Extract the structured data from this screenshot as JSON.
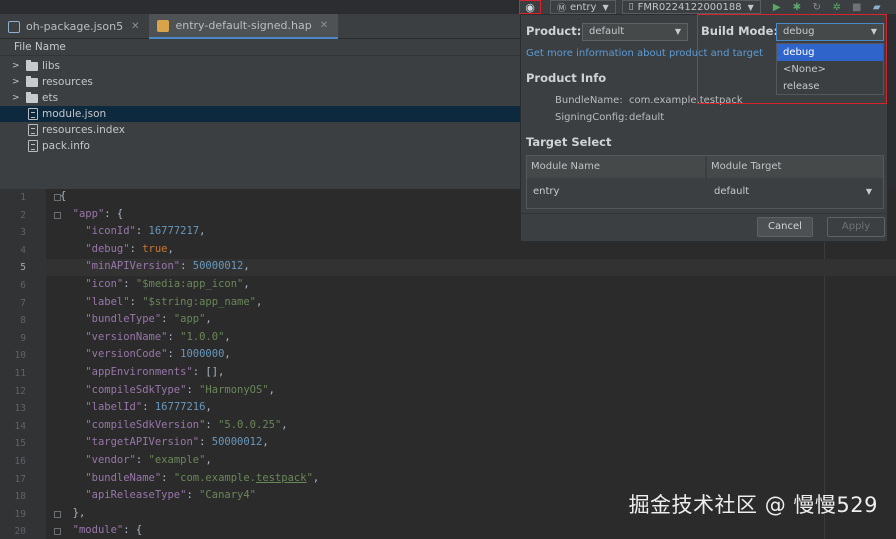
{
  "tabs": [
    {
      "label": "oh-package.json5",
      "icon": "json-file-icon",
      "active": false
    },
    {
      "label": "entry-default-signed.hap",
      "icon": "hap-archive-icon",
      "active": true
    }
  ],
  "tree": {
    "header": "File Name",
    "items": [
      {
        "label": "libs",
        "type": "folder"
      },
      {
        "label": "resources",
        "type": "folder"
      },
      {
        "label": "ets",
        "type": "folder"
      },
      {
        "label": "module.json",
        "type": "file",
        "selected": true
      },
      {
        "label": "resources.index",
        "type": "file"
      },
      {
        "label": "pack.info",
        "type": "file"
      }
    ]
  },
  "toolbar": {
    "module": "entry",
    "device": "FMR0224122000188"
  },
  "dialog": {
    "product_label": "Product:",
    "product_value": "default",
    "build_mode_label": "Build Mode:",
    "build_mode_value": "debug",
    "build_mode_options": [
      "debug",
      "<None>",
      "release"
    ],
    "more_info_link": "Get more information about product and target",
    "product_info_title": "Product Info",
    "bundle_name_label": "BundleName:",
    "bundle_name_value": "com.example.testpack",
    "signing_config_label": "SigningConfig:",
    "signing_config_value": "default",
    "target_select_title": "Target Select",
    "table_headers": [
      "Module Name",
      "Module Target"
    ],
    "table_row": {
      "module_name": "entry",
      "module_target": "default"
    },
    "cancel_label": "Cancel",
    "apply_label": "Apply"
  },
  "editor": {
    "current_line": 5,
    "line_numbers": [
      "1",
      "2",
      "3",
      "4",
      "5",
      "6",
      "7",
      "8",
      "9",
      "10",
      "11",
      "12",
      "13",
      "14",
      "15",
      "16",
      "17",
      "18",
      "19",
      "20"
    ],
    "lines": [
      "{",
      "  \"app\": {",
      "    \"iconId\": 16777217,",
      "    \"debug\": true,",
      "    \"minAPIVersion\": 50000012,",
      "    \"icon\": \"$media:app_icon\",",
      "    \"label\": \"$string:app_name\",",
      "    \"bundleType\": \"app\",",
      "    \"versionName\": \"1.0.0\",",
      "    \"versionCode\": 1000000,",
      "    \"appEnvironments\": [],",
      "    \"compileSdkType\": \"HarmonyOS\",",
      "    \"labelId\": 16777216,",
      "    \"compileSdkVersion\": \"5.0.0.25\",",
      "    \"targetAPIVersion\": 50000012,",
      "    \"vendor\": \"example\",",
      "    \"bundleName\": \"com.example.testpack\",",
      "    \"apiReleaseType\": \"Canary4\"",
      "  },",
      "  \"module\": {"
    ]
  },
  "watermark": "掘金技术社区 @ 慢慢529",
  "colors": {
    "accent": "#2f65ca",
    "highlight_box": "#d9232b",
    "link": "#5b9bd5"
  }
}
